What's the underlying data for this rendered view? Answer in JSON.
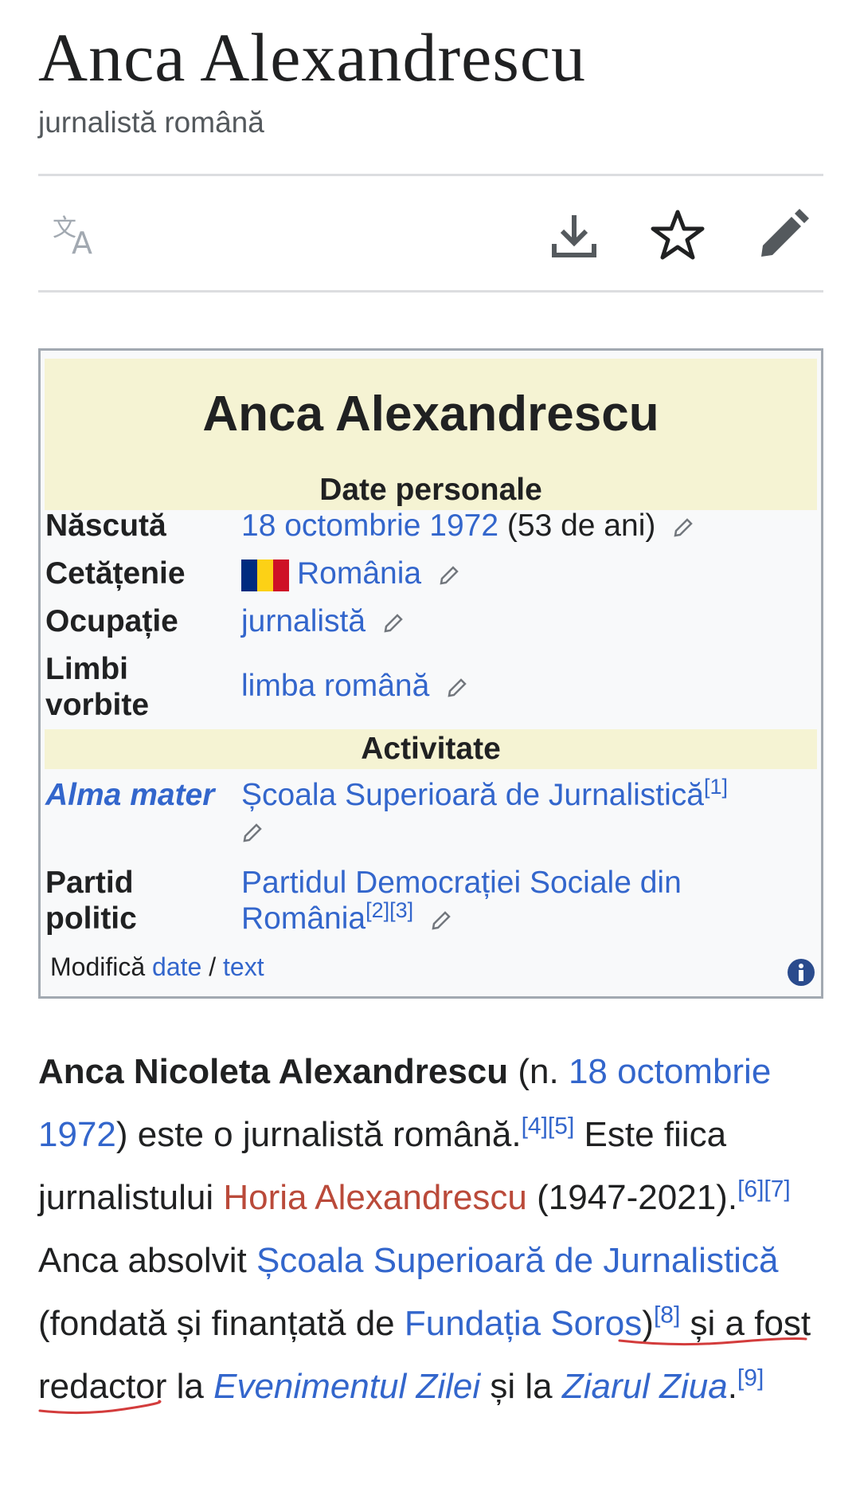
{
  "page": {
    "title": "Anca Alexandrescu",
    "description": "jurnalistă română"
  },
  "toolbar": {
    "icons": [
      "translate-icon",
      "download-icon",
      "star-icon",
      "edit-pencil-icon"
    ]
  },
  "infobox": {
    "title": "Anca Alexandrescu",
    "section_personal": "Date personale",
    "born_label": "Născută",
    "born_link": "18 octombrie 1972",
    "born_age": "(53 de ani)",
    "citizenship_label": "Cetățenie",
    "citizenship_value": "România",
    "occupation_label": "Ocupație",
    "occupation_value": "jurnalistă",
    "languages_label_1": "Limbi",
    "languages_label_2": "vorbite",
    "languages_value": "limba română",
    "section_activity": "Activitate",
    "alma_label": "Alma mater",
    "alma_value": "Școala Superioară de Jurnalistică",
    "alma_ref": "[1]",
    "party_label_1": "Partid",
    "party_label_2": "politic",
    "party_value_1": "Partidul Democrației Sociale din",
    "party_value_2": "România",
    "party_ref": "[2][3]",
    "footer_prefix": "Modifică",
    "footer_date": "date",
    "footer_sep": "/",
    "footer_text": "text"
  },
  "article": {
    "name_bold": "Anca Nicoleta Alexandrescu",
    "t1": " (n. ",
    "date_link": "18 octombrie 1972",
    "t2": ") este o jurnalistă română.",
    "ref45": "[4][5]",
    "t3": " Este fiica jurnalistului ",
    "father_link": "Horia Alexandrescu",
    "t4": " (1947-2021).",
    "ref67": "[6][7]",
    "t5": " Anca absolvit ",
    "school_link": "Școala Superioară de Jurnalistică",
    "t6": " (fondată și finanțată de ",
    "soros_link": "Fundația Soros",
    "t7": ")",
    "ref8": "[8]",
    "t8": " și a fost redactor la ",
    "evz_link": "Evenimentul Zilei",
    "t9": " și la ",
    "ziua_link": "Ziarul Ziua",
    "t10": ".",
    "ref9": "[9]"
  },
  "colors": {
    "link": "#3366cc",
    "redlink": "#ba4a3a",
    "infobox_header": "#f5f3d3",
    "annotation_underline": "#d33c3c"
  }
}
